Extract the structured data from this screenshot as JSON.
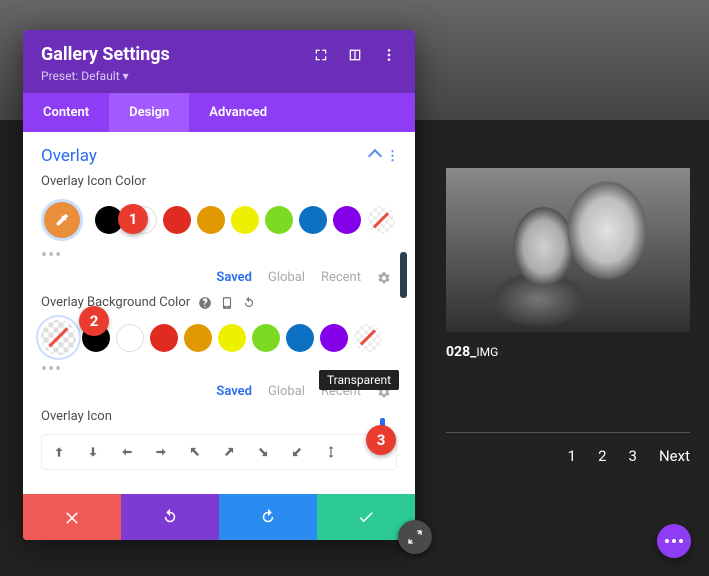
{
  "header": {
    "title": "Gallery Settings",
    "preset": "Preset: Default ▾"
  },
  "tabs": {
    "content": "Content",
    "design": "Design",
    "advanced": "Advanced"
  },
  "section": {
    "title": "Overlay"
  },
  "field1": {
    "label": "Overlay Icon Color"
  },
  "field2": {
    "label": "Overlay Background Color"
  },
  "field3": {
    "label": "Overlay Icon"
  },
  "swatch_footer": {
    "saved": "Saved",
    "global": "Global",
    "recent": "Recent"
  },
  "tooltip": {
    "text": "Transparent"
  },
  "colors": {
    "black": "#000000",
    "white": "#ffffff",
    "red": "#e02b20",
    "orange": "#e09900",
    "yellow": "#edf000",
    "green": "#7cda24",
    "blue": "#0c71c3",
    "purple": "#8300e9"
  },
  "gallery": {
    "caption_prefix": "028_",
    "caption_suffix": "IMG"
  },
  "pager": {
    "p1": "1",
    "p2": "2",
    "p3": "3",
    "next": "Next"
  },
  "callouts": {
    "c1": "1",
    "c2": "2",
    "c3": "3"
  }
}
